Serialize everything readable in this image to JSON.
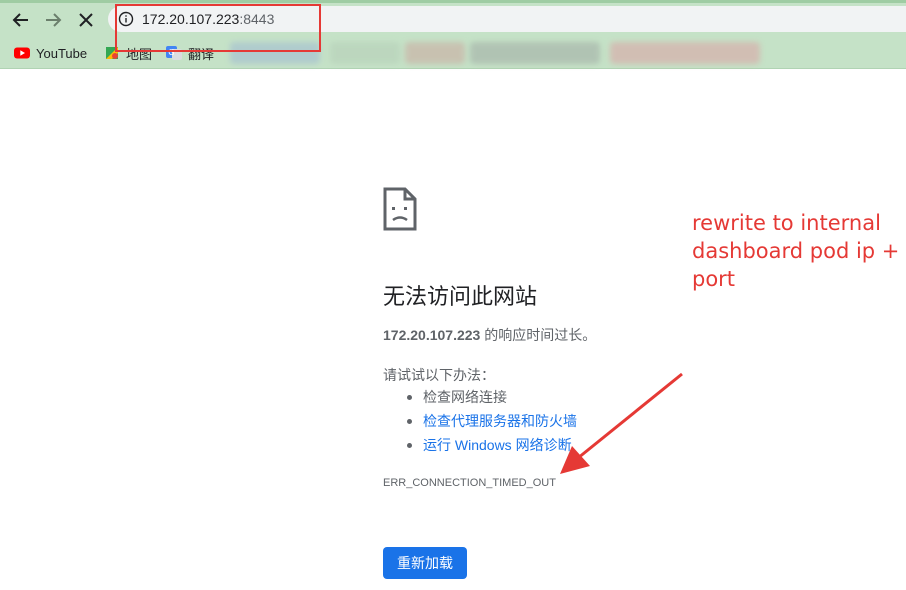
{
  "browser": {
    "url": {
      "host": "172.20.107.223",
      "port": ":8443"
    },
    "bookmarks": [
      {
        "label": "YouTube",
        "icon": "youtube-icon"
      },
      {
        "label": "地图",
        "icon": "maps-icon"
      },
      {
        "label": "翻译",
        "icon": "translate-icon"
      }
    ]
  },
  "error_page": {
    "title": "无法访问此网站",
    "desc_host": "172.20.107.223",
    "desc_rest": " 的响应时间过长。",
    "suggestions_heading": "请试试以下办法：",
    "suggestions": [
      {
        "label": "检查网络连接",
        "link": false
      },
      {
        "label": "检查代理服务器和防火墙",
        "link": true
      },
      {
        "label": "运行 Windows 网络诊断",
        "link": true
      }
    ],
    "error_code": "ERR_CONNECTION_TIMED_OUT",
    "reload_label": "重新加载"
  },
  "annotation": {
    "lines": [
      "rewrite to internal",
      "dashboard pod ip +",
      "port"
    ],
    "color": "#e53935"
  },
  "colors": {
    "chrome_bg": "#c5e2c7",
    "link": "#1a73e8",
    "button": "#1a73e8",
    "annotation": "#e53935"
  }
}
